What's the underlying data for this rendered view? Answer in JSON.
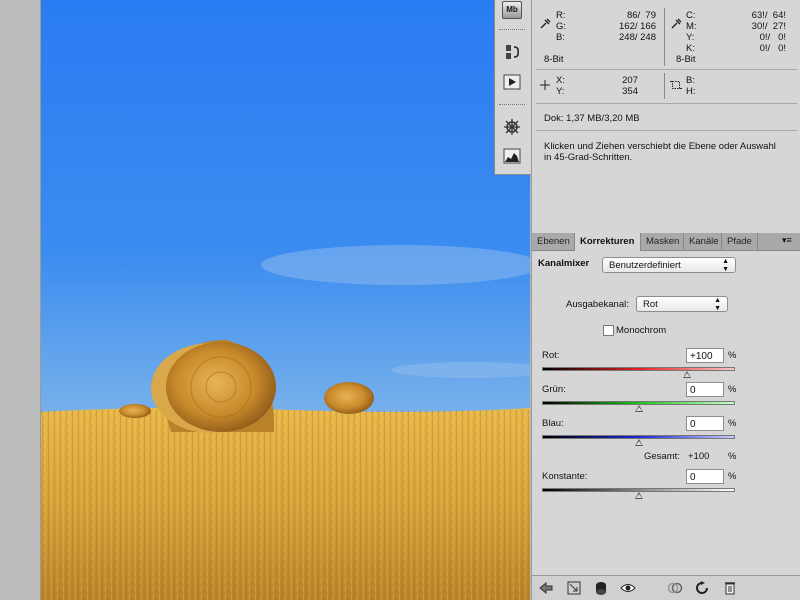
{
  "dock": {
    "mb_label": "Mb"
  },
  "info": {
    "r_label": "R:",
    "r_value": "86/  79",
    "g_label": "G:",
    "g_value": "162/ 166",
    "b_label": "B:",
    "b_value": "248/ 248",
    "bit_left": "8-Bit",
    "c_label": "C:",
    "c_value": "63!/  64!",
    "m_label": "M:",
    "m_value": "30!/  27!",
    "y_label": "Y:",
    "y_value": "0!/   0!",
    "k_label": "K:",
    "k_value": "0!/   0!",
    "bit_right": "8-Bit",
    "x_label": "X:",
    "x_value": "207",
    "ypos_label": "Y:",
    "ypos_value": "354",
    "w_label": "B:",
    "h_label": "H:",
    "doc": "Dok: 1,37 MB/3,20 MB",
    "hint": "Klicken und Ziehen verschiebt die Ebene oder Auswahl\nin 45-Grad-Schritten."
  },
  "panel": {
    "tabs": [
      {
        "label": "Ebenen"
      },
      {
        "label": "Korrekturen"
      },
      {
        "label": "Masken"
      },
      {
        "label": "Kanäle"
      },
      {
        "label": "Pfade"
      }
    ],
    "title": "Kanalmixer",
    "preset": "Benutzerdefiniert",
    "output_label": "Ausgabekanal:",
    "output_value": "Rot",
    "mono_label": "Monochrom",
    "percent": "%",
    "rot_label": "Rot:",
    "rot_value": "+100",
    "rot_level": 100,
    "gruen_label": "Grün:",
    "gruen_value": "0",
    "gruen_level": 0,
    "blau_label": "Blau:",
    "blau_value": "0",
    "blau_level": 0,
    "total_label": "Gesamt:",
    "total_value": "+100",
    "const_label": "Konstante:",
    "const_value": "0",
    "const_level": 0
  },
  "colors": {
    "sky_top": "#2f7ff0",
    "sky_bottom": "#6aa7ee",
    "field": "#d8a640",
    "hay": "#c98a2a"
  }
}
